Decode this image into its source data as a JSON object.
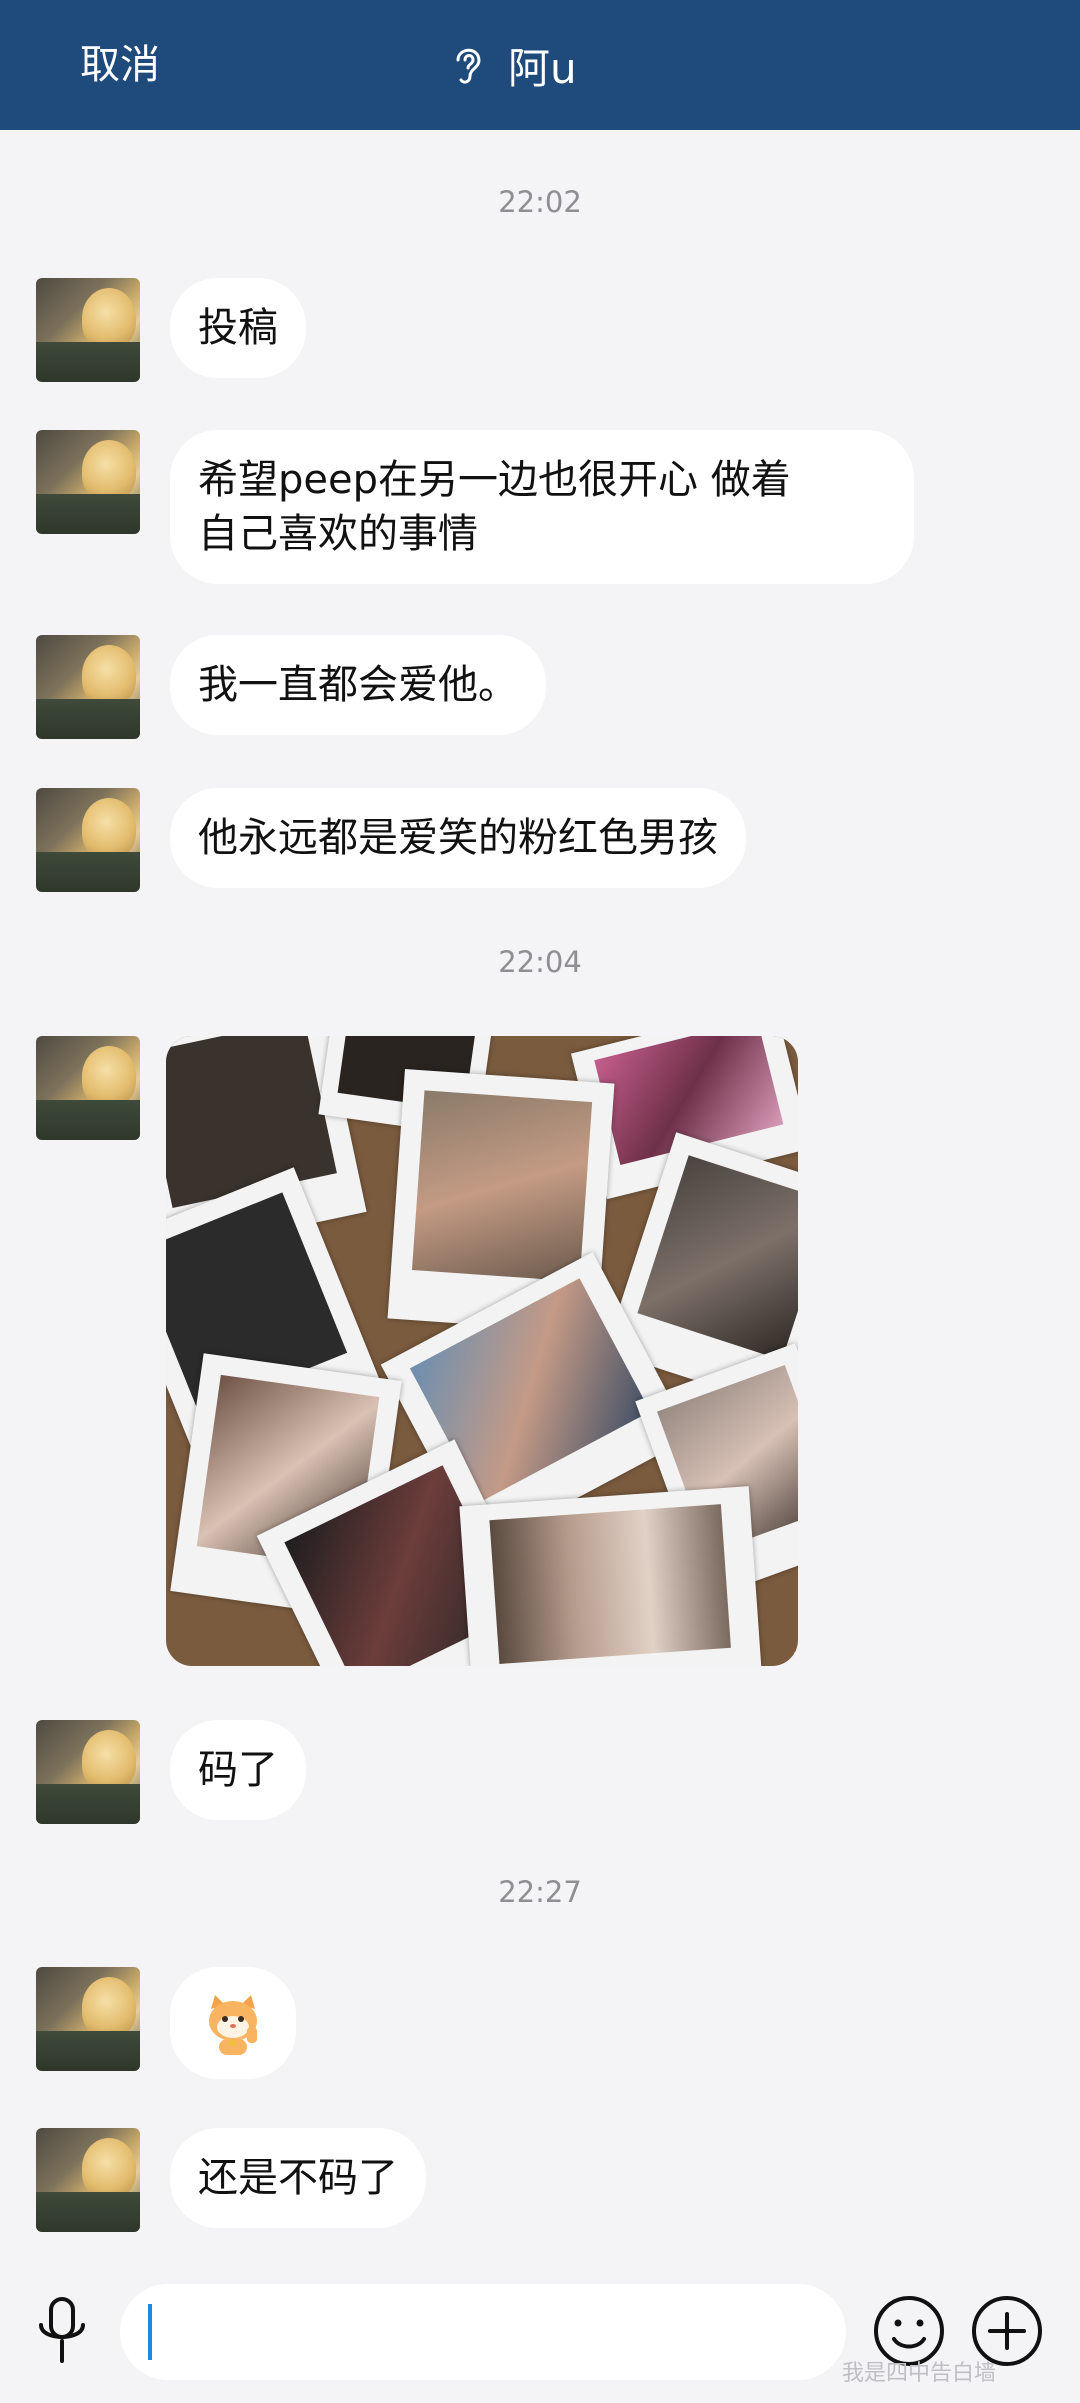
{
  "header": {
    "cancel_label": "取消",
    "title": "阿u",
    "title_icon": "ear-icon"
  },
  "messages": {
    "time1": "22:02",
    "m1": "投稿",
    "m2_line1": "希望peep在另一边也很开心  做着",
    "m2_line2": "自己喜欢的事情",
    "m3": "我一直都会爱他。",
    "m4": "他永远都是爱笑的粉红色男孩",
    "time2": "22:04",
    "m6": "码了",
    "time3": "22:27",
    "m8": "还是不码了"
  },
  "composer": {
    "input_value": "",
    "mic_icon": "microphone-icon",
    "emoji_icon": "emoji-icon",
    "plus_icon": "plus-icon"
  },
  "watermark": "我是四中告白墙",
  "colors": {
    "header_bg": "#1f4a7c",
    "chat_bg": "#f4f4f6",
    "bubble_bg": "#ffffff",
    "caret": "#1e88e5"
  }
}
